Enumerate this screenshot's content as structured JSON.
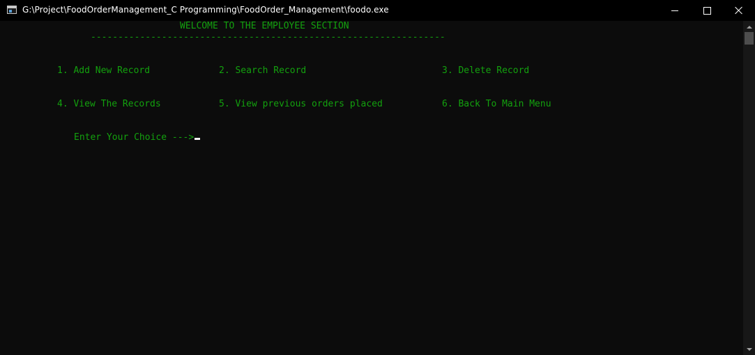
{
  "window": {
    "title": "G:\\Project\\FoodOrderManagement_C Programming\\FoodOrder_Management\\foodo.exe",
    "icon": "console-app-icon"
  },
  "console": {
    "header": "WELCOME TO THE EMPLOYEE SECTION",
    "divider": "-----------------------------------------------------------------",
    "menu": [
      {
        "label": "1. Add New Record"
      },
      {
        "label": "2. Search Record"
      },
      {
        "label": "3. Delete Record"
      },
      {
        "label": "4. View The Records"
      },
      {
        "label": "5. View previous orders placed"
      },
      {
        "label": "6. Back To Main Menu"
      }
    ],
    "prompt": "Enter Your Choice --->",
    "text_color": "#13a10e",
    "background": "#0c0c0c"
  }
}
